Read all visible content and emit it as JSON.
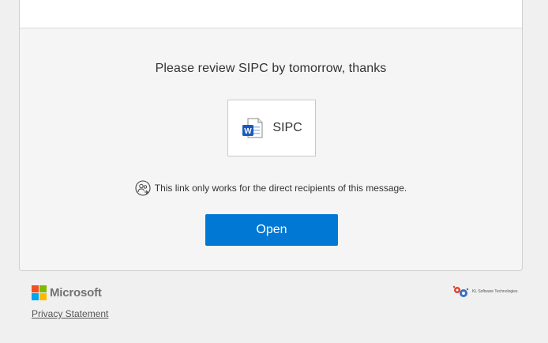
{
  "message": {
    "text": "Please review SIPC by tomorrow, thanks"
  },
  "file": {
    "name": "SIPC",
    "icon": "word-document-icon",
    "icon_color": "#185abd"
  },
  "notice": {
    "icon": "people-icon",
    "text": "This link only works for the direct recipients of this message."
  },
  "open_button": {
    "label": "Open",
    "color": "#0078d4"
  },
  "footer": {
    "brand_name": "Microsoft",
    "brand_colors": [
      "#f25022",
      "#7fba00",
      "#00a4ef",
      "#ffb900"
    ],
    "privacy_link": "Privacy Statement",
    "partner_logo_text": "KL Software Technologies"
  }
}
